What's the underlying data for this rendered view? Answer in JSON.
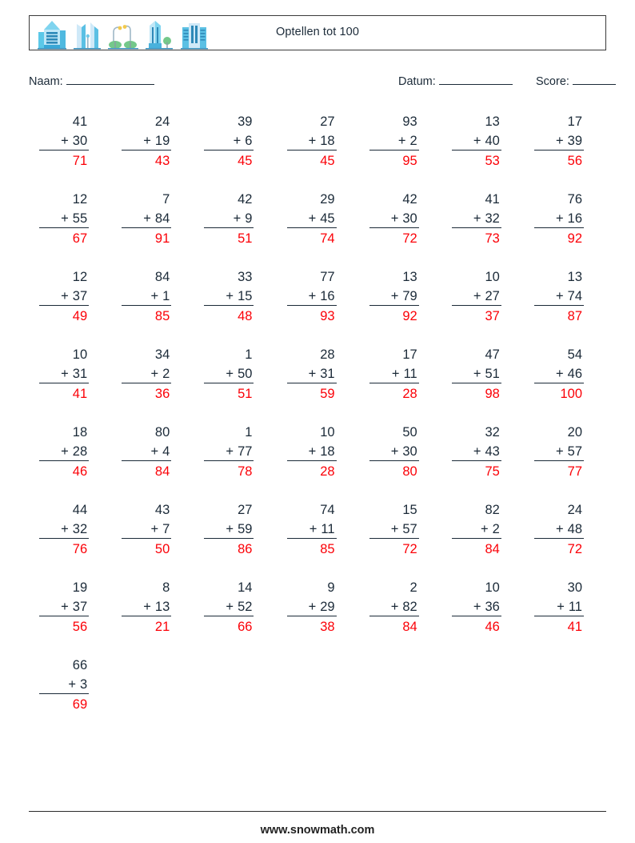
{
  "header": {
    "title": "Optellen tot 100",
    "icons": [
      "building-tower-icon",
      "twin-skyscraper-icon",
      "streetlamp-park-icon",
      "glass-tower-tree-icon",
      "office-block-icon"
    ]
  },
  "meta": {
    "name_label": "Naam:",
    "date_label": "Datum:",
    "score_label": "Score:",
    "name_value": "",
    "date_value": "",
    "score_value": ""
  },
  "footer": {
    "site": "www.snowmath.com"
  },
  "colors": {
    "answer": "#fb0007",
    "text": "#1b2a38",
    "rule": "#1b2a38"
  },
  "worksheet": {
    "operator": "+",
    "columns": 7,
    "rows": 8,
    "problems": [
      {
        "top": "41",
        "op": "+",
        "bottom": "30",
        "answer": "71"
      },
      {
        "top": "24",
        "op": "+",
        "bottom": "19",
        "answer": "43"
      },
      {
        "top": "39",
        "op": "+",
        "bottom": "6",
        "answer": "45"
      },
      {
        "top": "27",
        "op": "+",
        "bottom": "18",
        "answer": "45"
      },
      {
        "top": "93",
        "op": "+",
        "bottom": "2",
        "answer": "95"
      },
      {
        "top": "13",
        "op": "+",
        "bottom": "40",
        "answer": "53"
      },
      {
        "top": "17",
        "op": "+",
        "bottom": "39",
        "answer": "56"
      },
      {
        "top": "12",
        "op": "+",
        "bottom": "55",
        "answer": "67"
      },
      {
        "top": "7",
        "op": "+",
        "bottom": "84",
        "answer": "91"
      },
      {
        "top": "42",
        "op": "+",
        "bottom": "9",
        "answer": "51"
      },
      {
        "top": "29",
        "op": "+",
        "bottom": "45",
        "answer": "74"
      },
      {
        "top": "42",
        "op": "+",
        "bottom": "30",
        "answer": "72"
      },
      {
        "top": "41",
        "op": "+",
        "bottom": "32",
        "answer": "73"
      },
      {
        "top": "76",
        "op": "+",
        "bottom": "16",
        "answer": "92"
      },
      {
        "top": "12",
        "op": "+",
        "bottom": "37",
        "answer": "49"
      },
      {
        "top": "84",
        "op": "+",
        "bottom": "1",
        "answer": "85"
      },
      {
        "top": "33",
        "op": "+",
        "bottom": "15",
        "answer": "48"
      },
      {
        "top": "77",
        "op": "+",
        "bottom": "16",
        "answer": "93"
      },
      {
        "top": "13",
        "op": "+",
        "bottom": "79",
        "answer": "92"
      },
      {
        "top": "10",
        "op": "+",
        "bottom": "27",
        "answer": "37"
      },
      {
        "top": "13",
        "op": "+",
        "bottom": "74",
        "answer": "87"
      },
      {
        "top": "10",
        "op": "+",
        "bottom": "31",
        "answer": "41"
      },
      {
        "top": "34",
        "op": "+",
        "bottom": "2",
        "answer": "36"
      },
      {
        "top": "1",
        "op": "+",
        "bottom": "50",
        "answer": "51"
      },
      {
        "top": "28",
        "op": "+",
        "bottom": "31",
        "answer": "59"
      },
      {
        "top": "17",
        "op": "+",
        "bottom": "11",
        "answer": "28"
      },
      {
        "top": "47",
        "op": "+",
        "bottom": "51",
        "answer": "98"
      },
      {
        "top": "54",
        "op": "+",
        "bottom": "46",
        "answer": "100"
      },
      {
        "top": "18",
        "op": "+",
        "bottom": "28",
        "answer": "46"
      },
      {
        "top": "80",
        "op": "+",
        "bottom": "4",
        "answer": "84"
      },
      {
        "top": "1",
        "op": "+",
        "bottom": "77",
        "answer": "78"
      },
      {
        "top": "10",
        "op": "+",
        "bottom": "18",
        "answer": "28"
      },
      {
        "top": "50",
        "op": "+",
        "bottom": "30",
        "answer": "80"
      },
      {
        "top": "32",
        "op": "+",
        "bottom": "43",
        "answer": "75"
      },
      {
        "top": "20",
        "op": "+",
        "bottom": "57",
        "answer": "77"
      },
      {
        "top": "44",
        "op": "+",
        "bottom": "32",
        "answer": "76"
      },
      {
        "top": "43",
        "op": "+",
        "bottom": "7",
        "answer": "50"
      },
      {
        "top": "27",
        "op": "+",
        "bottom": "59",
        "answer": "86"
      },
      {
        "top": "74",
        "op": "+",
        "bottom": "11",
        "answer": "85"
      },
      {
        "top": "15",
        "op": "+",
        "bottom": "57",
        "answer": "72"
      },
      {
        "top": "82",
        "op": "+",
        "bottom": "2",
        "answer": "84"
      },
      {
        "top": "24",
        "op": "+",
        "bottom": "48",
        "answer": "72"
      },
      {
        "top": "19",
        "op": "+",
        "bottom": "37",
        "answer": "56"
      },
      {
        "top": "8",
        "op": "+",
        "bottom": "13",
        "answer": "21"
      },
      {
        "top": "14",
        "op": "+",
        "bottom": "52",
        "answer": "66"
      },
      {
        "top": "9",
        "op": "+",
        "bottom": "29",
        "answer": "38"
      },
      {
        "top": "2",
        "op": "+",
        "bottom": "82",
        "answer": "84"
      },
      {
        "top": "10",
        "op": "+",
        "bottom": "36",
        "answer": "46"
      },
      {
        "top": "30",
        "op": "+",
        "bottom": "11",
        "answer": "41"
      },
      {
        "top": "66",
        "op": "+",
        "bottom": "3",
        "answer": "69"
      }
    ]
  }
}
